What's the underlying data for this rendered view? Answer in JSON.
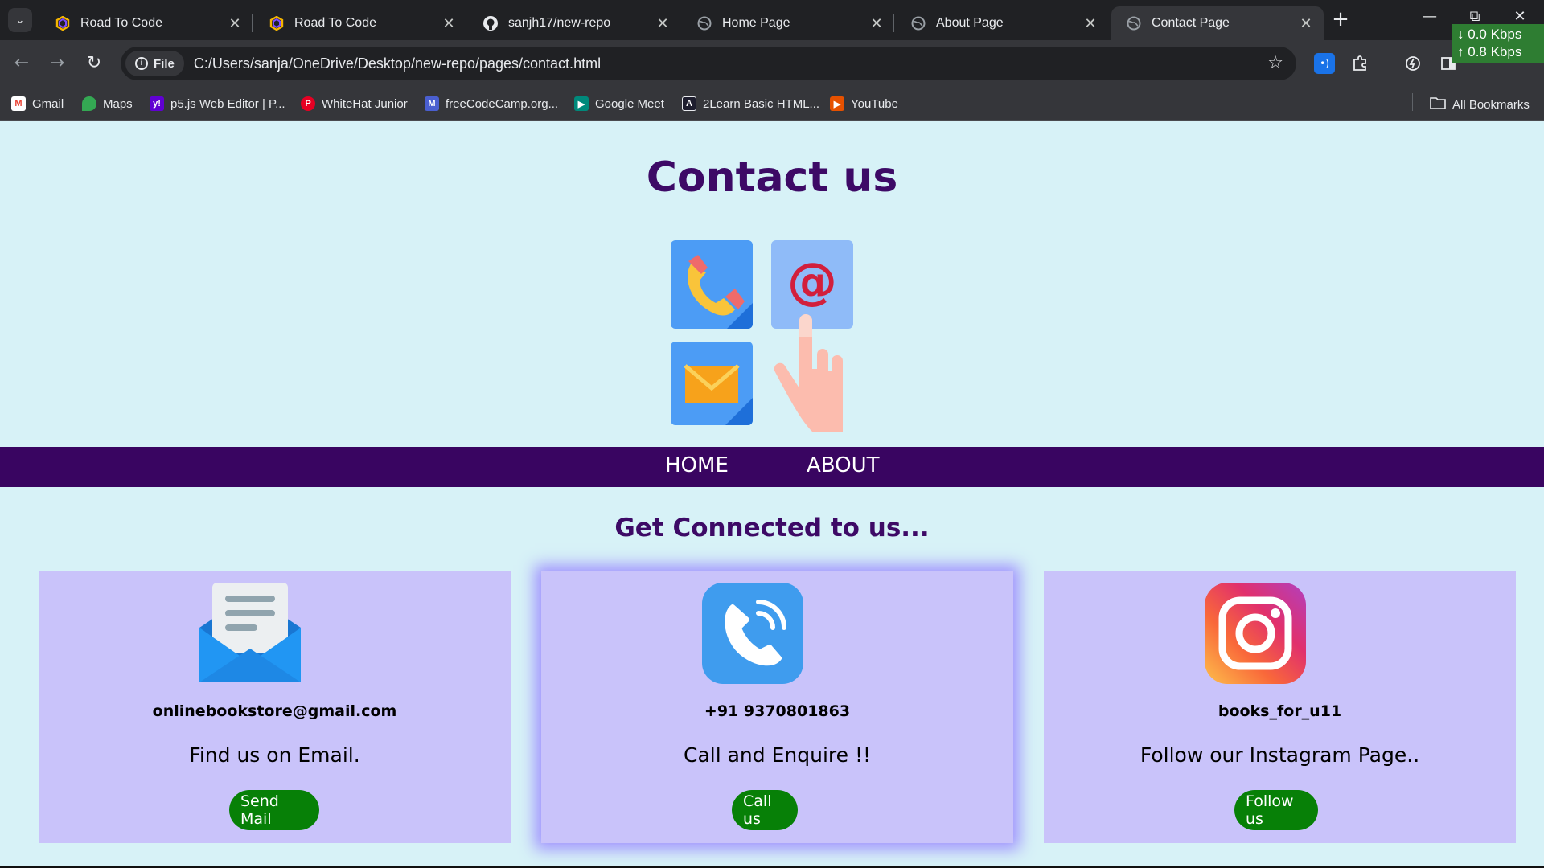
{
  "browser": {
    "tabs": [
      {
        "title": "Road To Code",
        "active": false
      },
      {
        "title": "Road To Code",
        "active": false
      },
      {
        "title": "sanjh17/new-repo",
        "active": false
      },
      {
        "title": "Home Page",
        "active": false
      },
      {
        "title": "About Page",
        "active": false
      },
      {
        "title": "Contact Page",
        "active": true
      }
    ],
    "new_tab_symbol": "+",
    "address": {
      "chip_label": "File",
      "url": "C:/Users/sanja/OneDrive/Desktop/new-repo/pages/contact.html"
    },
    "net_speed": {
      "down": "0.0 Kbps",
      "up": "0.8 Kbps"
    },
    "bookmarks": [
      {
        "label": "Gmail",
        "icon": "gmail-icon"
      },
      {
        "label": "Maps",
        "icon": "maps-icon"
      },
      {
        "label": "p5.js Web Editor | P...",
        "icon": "p5js-icon"
      },
      {
        "label": "WhiteHat Junior",
        "icon": "pinterest-icon"
      },
      {
        "label": "freeCodeCamp.org...",
        "icon": "freecodecamp-icon"
      },
      {
        "label": "Google Meet",
        "icon": "meet-icon"
      },
      {
        "label": "2Learn Basic HTML...",
        "icon": "2learn-icon"
      },
      {
        "label": "YouTube",
        "icon": "youtube-icon"
      }
    ],
    "all_bookmarks_label": "All Bookmarks"
  },
  "page": {
    "heading": "Contact us",
    "nav": {
      "home": "HOME",
      "about": "ABOUT"
    },
    "subheading": "Get Connected to us...",
    "cards": [
      {
        "handle": "onlinebookstore@gmail.com",
        "description": "Find us on Email.",
        "button": "Send Mail",
        "icon": "email-envelope-icon"
      },
      {
        "handle": "+91 9370801863",
        "description": "Call and Enquire !!",
        "button": "Call us",
        "icon": "phone-call-icon"
      },
      {
        "handle": "books_for_u11",
        "description": "Follow our Instagram Page..",
        "button": "Follow us",
        "icon": "instagram-icon"
      }
    ]
  },
  "colors": {
    "page_background": "#d7f2f7",
    "heading_purple": "#3d0a66",
    "navbar_purple": "#390561",
    "card_lavender": "#c9c3fa",
    "button_green": "#078007"
  }
}
